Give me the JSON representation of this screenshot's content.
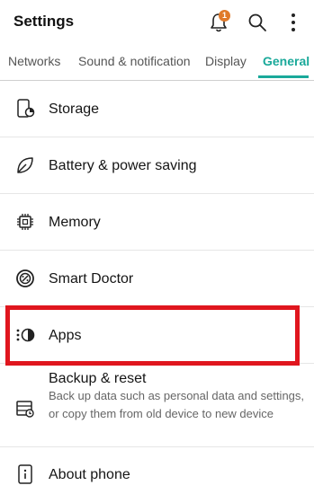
{
  "header": {
    "title": "Settings",
    "notification_count": "1",
    "icons": [
      "bell-icon",
      "search-icon",
      "more-vert-icon"
    ]
  },
  "tabs": [
    {
      "label": "Networks",
      "active": false
    },
    {
      "label": "Sound & notification",
      "active": false
    },
    {
      "label": "Display",
      "active": false
    },
    {
      "label": "General",
      "active": true
    }
  ],
  "accent_color": "#1aa99a",
  "highlight_color": "#e0161e",
  "items": [
    {
      "label": "Storage",
      "icon": "storage-icon"
    },
    {
      "label": "Battery & power saving",
      "icon": "battery-leaf-icon"
    },
    {
      "label": "Memory",
      "icon": "memory-chip-icon"
    },
    {
      "label": "Smart Doctor",
      "icon": "smart-doctor-icon"
    },
    {
      "label": "Apps",
      "icon": "apps-icon",
      "highlighted": true
    },
    {
      "label": "Backup & reset",
      "description": "Back up data such as personal data and settings, or copy them from old device to new device",
      "icon": "backup-icon"
    },
    {
      "label": "About phone",
      "icon": "info-icon"
    }
  ]
}
